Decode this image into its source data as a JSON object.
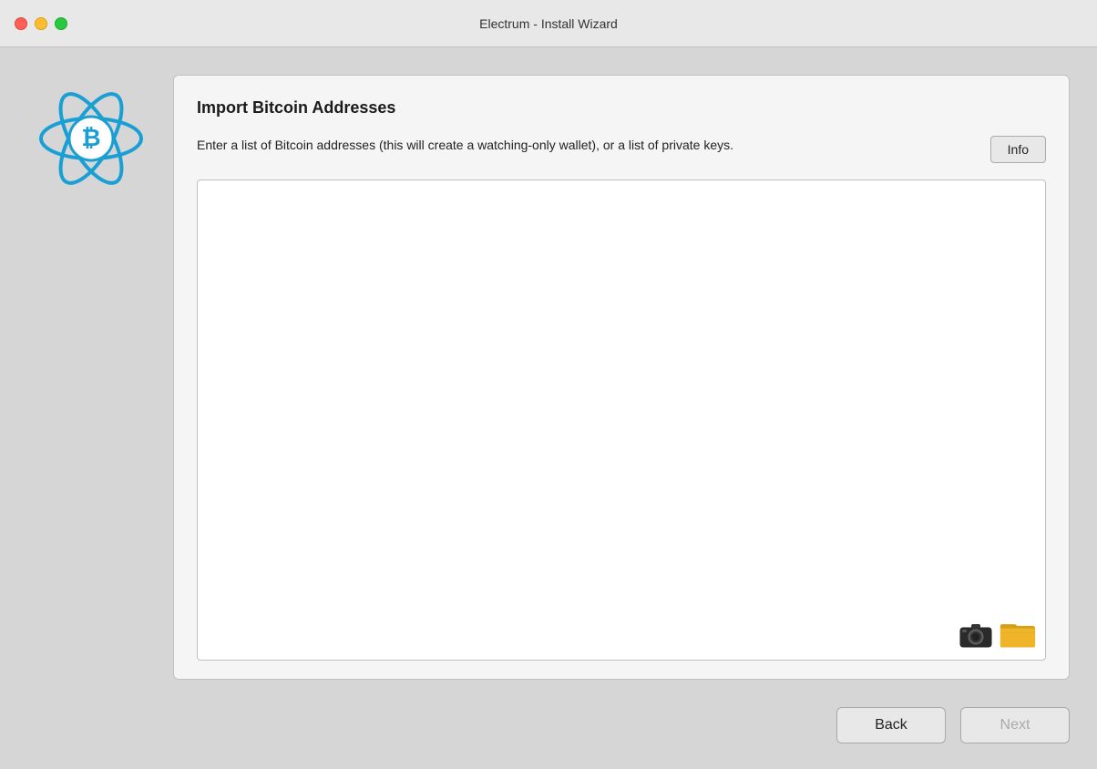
{
  "window": {
    "title": "Electrum  -  Install Wizard"
  },
  "traffic_lights": {
    "close_label": "close",
    "minimize_label": "minimize",
    "maximize_label": "maximize"
  },
  "panel": {
    "title": "Import Bitcoin Addresses",
    "description": "Enter a list of Bitcoin addresses (this will create a watching-only wallet), or a list of private keys.",
    "info_button_label": "Info",
    "textarea_placeholder": ""
  },
  "buttons": {
    "back_label": "Back",
    "next_label": "Next"
  }
}
